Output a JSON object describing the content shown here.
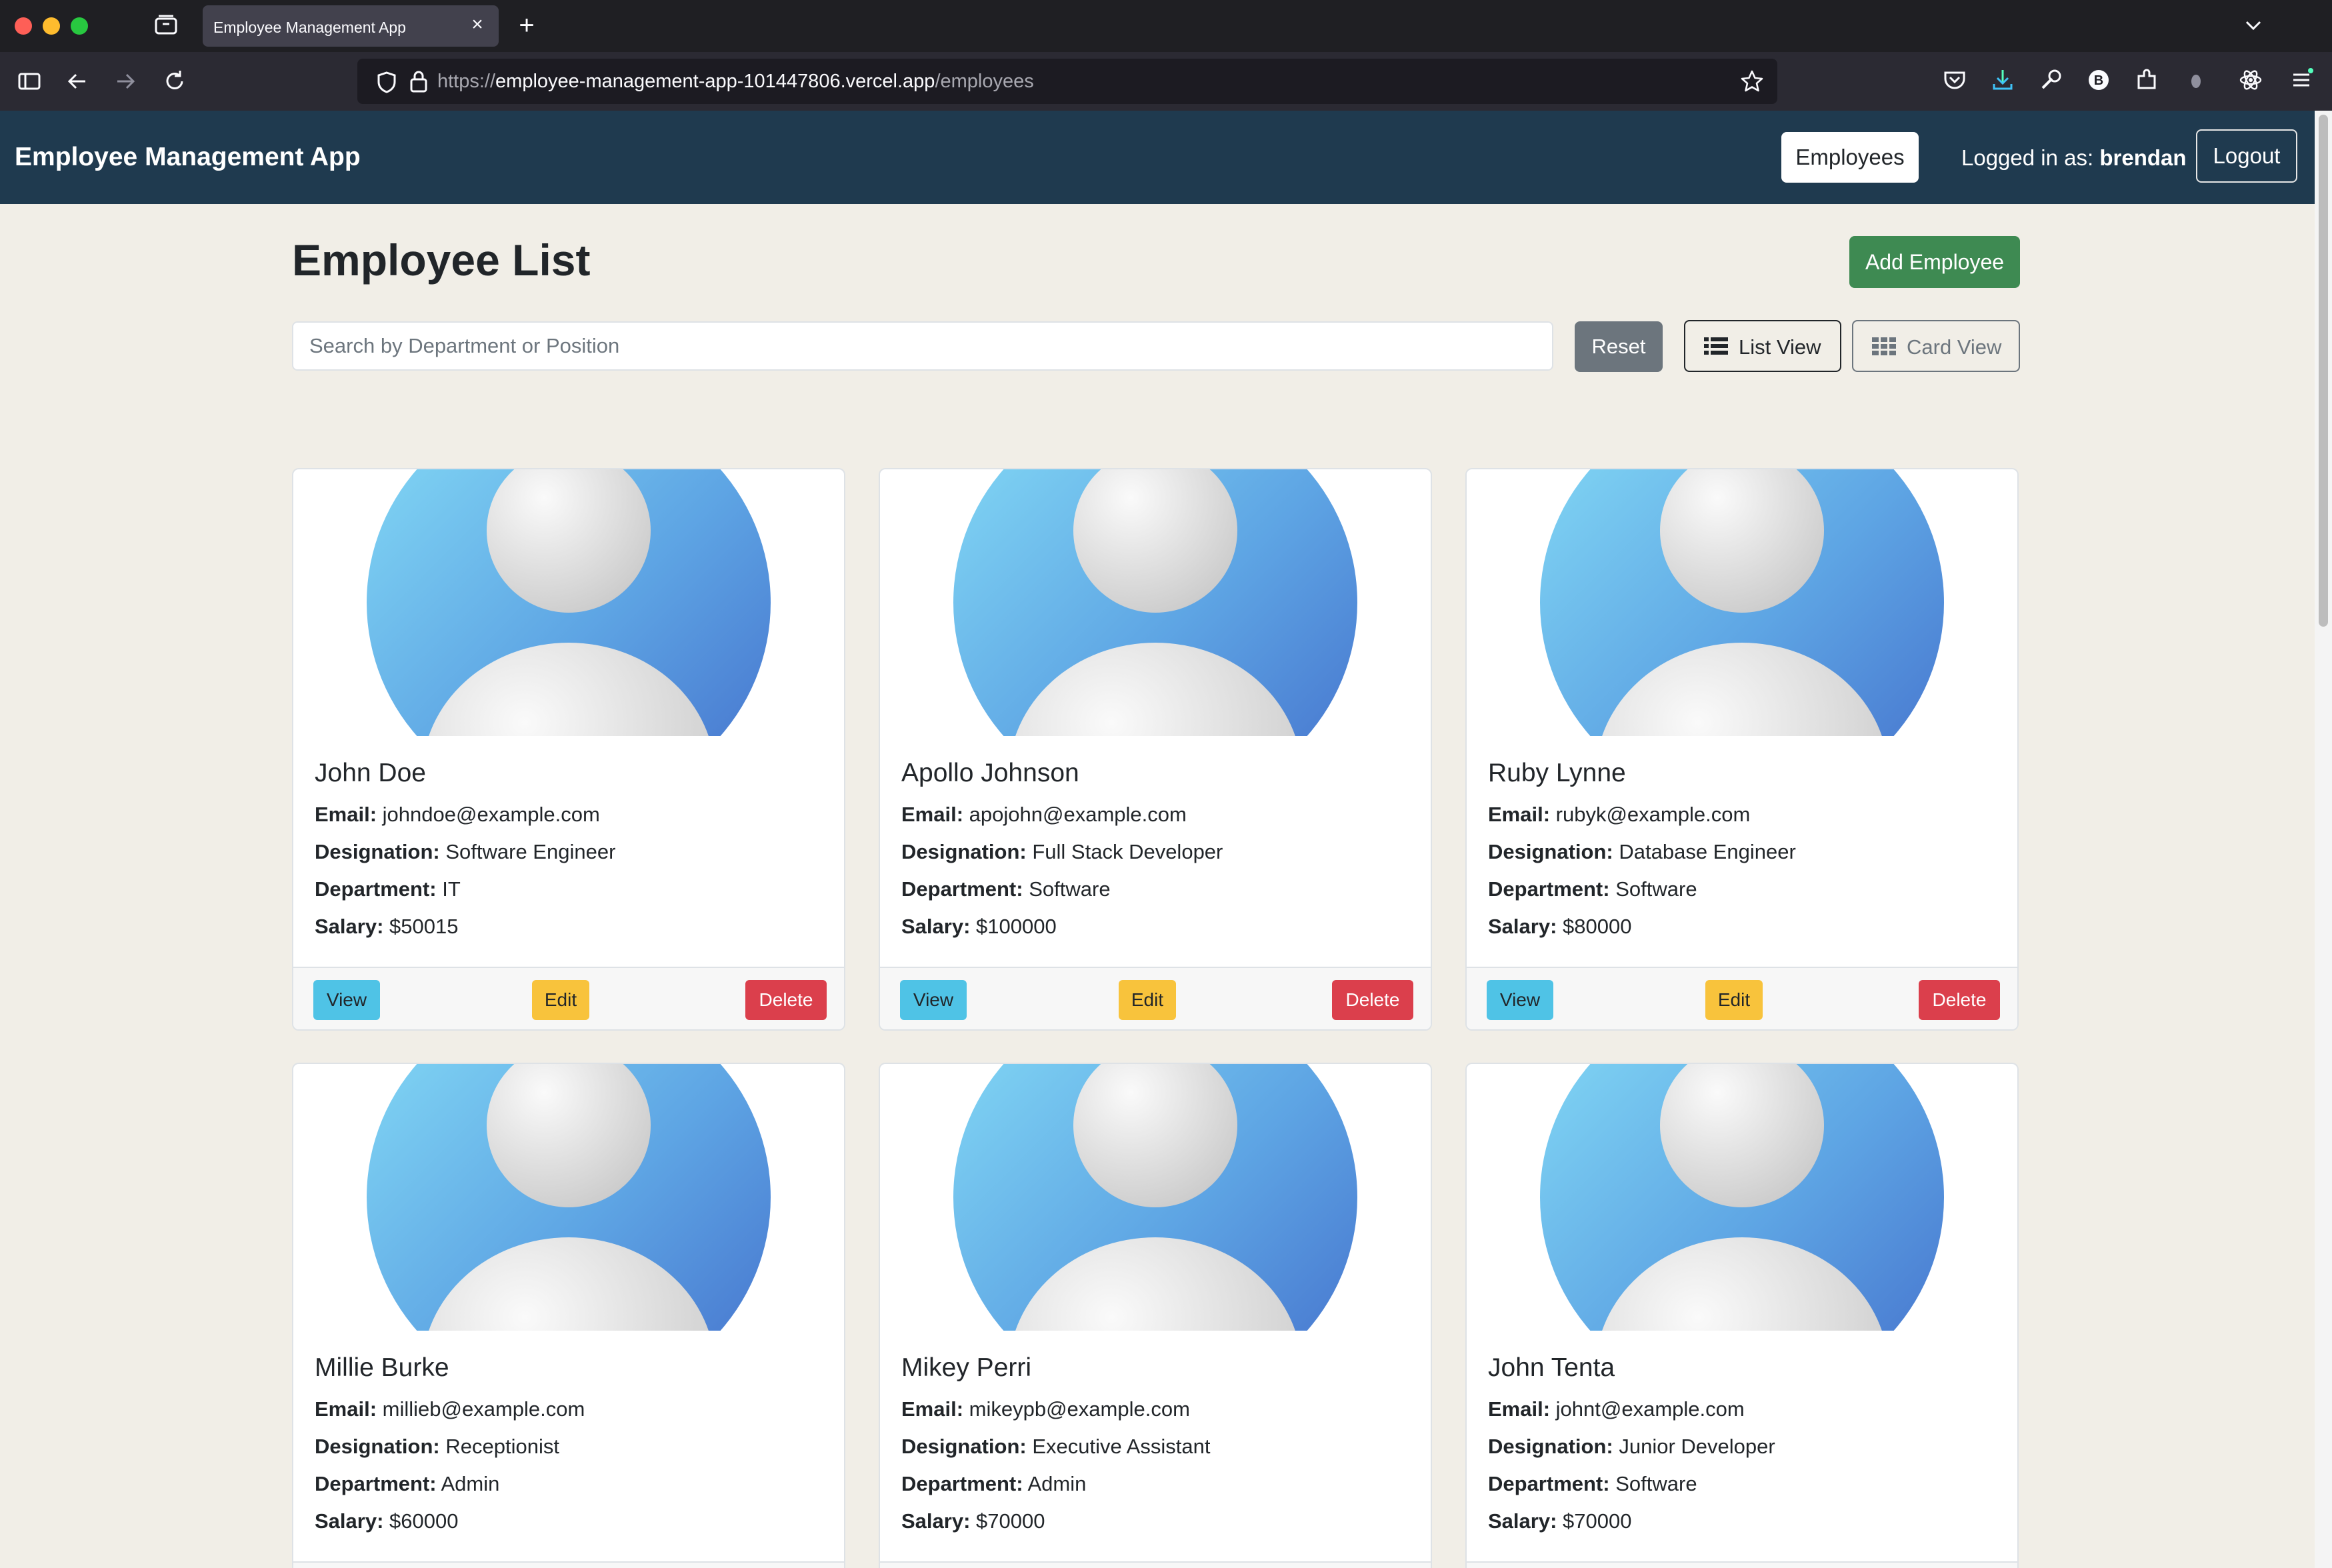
{
  "browser": {
    "tab_title": "Employee Management App",
    "tab_close": "×",
    "new_tab": "+",
    "url_prefix": "https://",
    "url_host": "employee-management-app-101447806.vercel.app",
    "url_path": "/employees"
  },
  "app": {
    "brand": "Employee Management App",
    "nav_employees": "Employees",
    "logged_in_prefix": "Logged in as:",
    "username": "brendan",
    "logout": "Logout"
  },
  "page": {
    "title": "Employee List",
    "add_button": "Add Employee",
    "search_placeholder": "Search by Department or Position",
    "reset_button": "Reset",
    "list_view": "List View",
    "card_view": "Card View"
  },
  "labels": {
    "email": "Email:",
    "designation": "Designation:",
    "department": "Department:",
    "salary": "Salary:",
    "view": "View",
    "edit": "Edit",
    "delete": "Delete"
  },
  "employees": [
    {
      "name": "John Doe",
      "email": "johndoe@example.com",
      "designation": "Software Engineer",
      "department": "IT",
      "salary": "$50015"
    },
    {
      "name": "Apollo Johnson",
      "email": "apojohn@example.com",
      "designation": "Full Stack Developer",
      "department": "Software",
      "salary": "$100000"
    },
    {
      "name": "Ruby Lynne",
      "email": "rubyk@example.com",
      "designation": "Database Engineer",
      "department": "Software",
      "salary": "$80000"
    },
    {
      "name": "Millie Burke",
      "email": "millieb@example.com",
      "designation": "Receptionist",
      "department": "Admin",
      "salary": "$60000"
    },
    {
      "name": "Mikey Perri",
      "email": "mikeypb@example.com",
      "designation": "Executive Assistant",
      "department": "Admin",
      "salary": "$70000"
    },
    {
      "name": "John Tenta",
      "email": "johnt@example.com",
      "designation": "Junior Developer",
      "department": "Software",
      "salary": "$70000"
    }
  ],
  "colors": {
    "app_nav": "#1f3a4f",
    "add_button": "#3e8a52",
    "view_button": "#4fc3e6",
    "edit_button": "#f8c33c",
    "delete_button": "#db3f4c"
  }
}
